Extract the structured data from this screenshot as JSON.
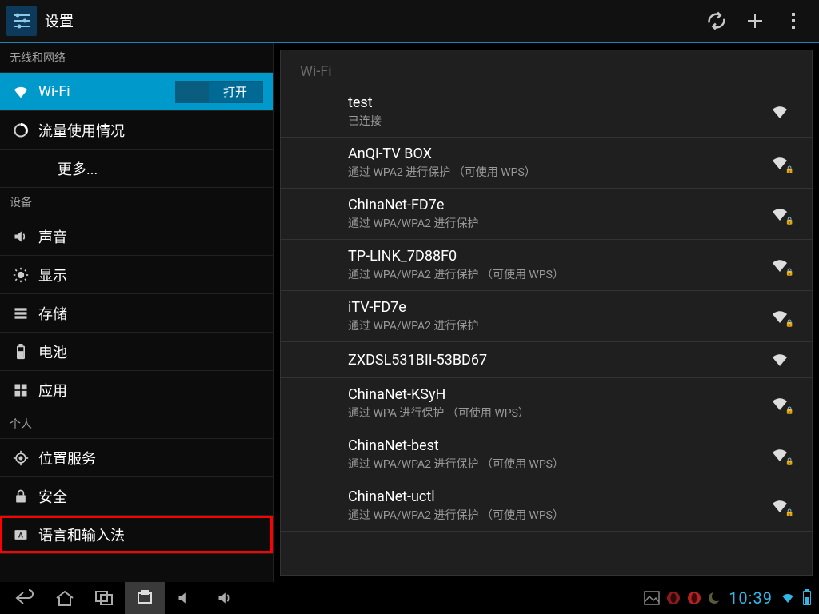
{
  "app": {
    "title": "设置"
  },
  "sidebar": {
    "section_wireless": "无线和网络",
    "section_device": "设备",
    "section_personal": "个人",
    "wifi_label": "Wi-Fi",
    "wifi_toggle": "打开",
    "items": {
      "data_usage": "流量使用情况",
      "more": "更多...",
      "sound": "声音",
      "display": "显示",
      "storage": "存储",
      "battery": "电池",
      "apps": "应用",
      "location": "位置服务",
      "security": "安全",
      "language_input": "语言和输入法"
    }
  },
  "content": {
    "panel_title": "Wi-Fi",
    "networks": [
      {
        "name": "test",
        "desc": "已连接",
        "secured": false
      },
      {
        "name": "AnQi-TV BOX",
        "desc": "通过 WPA2 进行保护 （可使用 WPS）",
        "secured": true
      },
      {
        "name": "ChinaNet-FD7e",
        "desc": "通过 WPA/WPA2 进行保护",
        "secured": true
      },
      {
        "name": "TP-LINK_7D88F0",
        "desc": "通过 WPA/WPA2 进行保护 （可使用 WPS）",
        "secured": true
      },
      {
        "name": "iTV-FD7e",
        "desc": "通过 WPA/WPA2 进行保护",
        "secured": true
      },
      {
        "name": "ZXDSL531BII-53BD67",
        "desc": "",
        "secured": false
      },
      {
        "name": "ChinaNet-KSyH",
        "desc": "通过 WPA 进行保护 （可使用 WPS）",
        "secured": true
      },
      {
        "name": "ChinaNet-best",
        "desc": "通过 WPA/WPA2 进行保护 （可使用 WPS）",
        "secured": true
      },
      {
        "name": "ChinaNet-uctl",
        "desc": "通过 WPA/WPA2 进行保护 （可使用 WPS）",
        "secured": true
      }
    ]
  },
  "statusbar": {
    "clock": "10:39"
  }
}
